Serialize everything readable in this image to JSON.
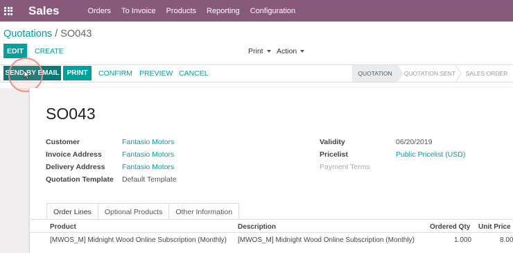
{
  "app": {
    "name": "Sales"
  },
  "menu": [
    "Orders",
    "To Invoice",
    "Products",
    "Reporting",
    "Configuration"
  ],
  "breadcrumb": {
    "parent": "Quotations",
    "separator": " / ",
    "current": "SO043"
  },
  "toolbar": {
    "edit_label": "EDIT",
    "create_label": "CREATE",
    "print_label": "Print",
    "action_label": "Action"
  },
  "statusbar": {
    "send_email_label": "SEND BY EMAIL",
    "print_label": "PRINT",
    "confirm_label": "CONFIRM",
    "preview_label": "PREVIEW",
    "cancel_label": "CANCEL",
    "stages": [
      "QUOTATION",
      "QUOTATION SENT",
      "SALES ORDER"
    ],
    "active_stage": "QUOTATION"
  },
  "form": {
    "title": "SO043",
    "customer_label": "Customer",
    "customer": "Fantasio Motors",
    "invoice_address_label": "Invoice Address",
    "invoice_address": "Fantasio Motors",
    "delivery_address_label": "Delivery Address",
    "delivery_address": "Fantasio Motors",
    "template_label": "Quotation Template",
    "template": "Default Template",
    "validity_label": "Validity",
    "validity": "06/20/2019",
    "pricelist_label": "Pricelist",
    "pricelist": "Public Pricelist (USD)",
    "payment_terms_label": "Payment Terms"
  },
  "tabs": [
    "Order Lines",
    "Optional Products",
    "Other Information"
  ],
  "order_lines": {
    "columns": [
      "Product",
      "Description",
      "Ordered Qty",
      "Unit Price"
    ],
    "rows": [
      {
        "product": "[MWOS_M] Midnight Wood Online Subscription (Monthly)",
        "description": "[MWOS_M] Midnight Wood Online Subscription (Monthly)",
        "qty": "1.000",
        "unit_price": "8.00"
      }
    ]
  },
  "colors": {
    "brand": "#875a7b",
    "primary": "#00a09d",
    "cursor_ring": "#f08b8b"
  }
}
